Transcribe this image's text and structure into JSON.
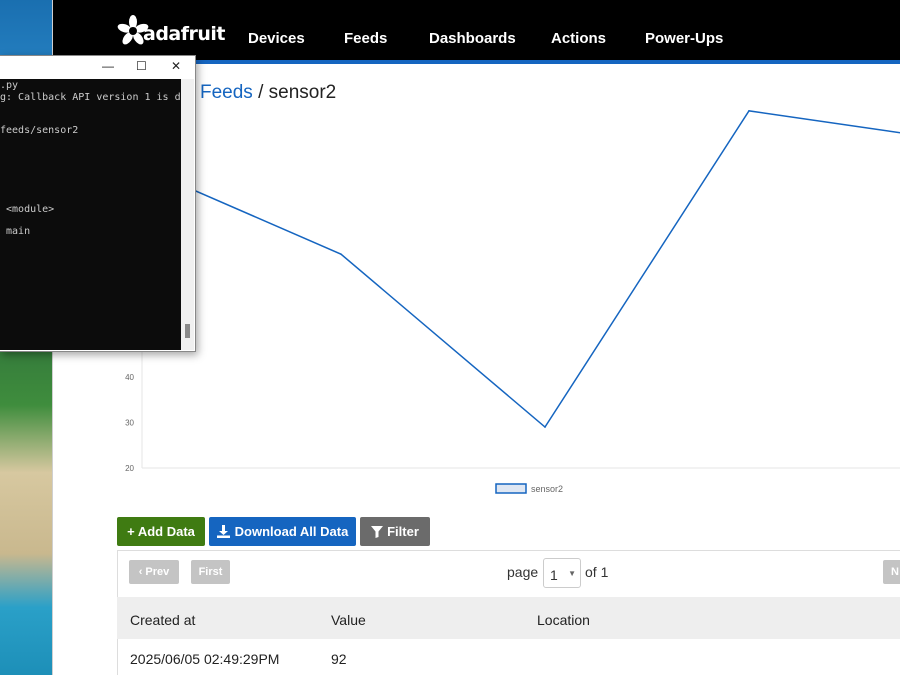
{
  "nav": {
    "logo_text": "adafruit",
    "items": [
      "Devices",
      "Feeds",
      "Dashboards",
      "Actions",
      "Power-Ups"
    ]
  },
  "breadcrumb": {
    "link": "Feeds",
    "separator": "/",
    "current": "sensor2"
  },
  "chart_data": {
    "type": "line",
    "title": "",
    "xlabel": "",
    "ylabel": "",
    "y_ticks_visible": [
      20,
      30,
      40
    ],
    "ylim": [
      20,
      100
    ],
    "series": [
      {
        "name": "sensor2",
        "color": "#1565c0",
        "values": [
          86.5,
          67,
          29,
          98.5,
          92
        ]
      }
    ],
    "legend": {
      "position": "bottom-center",
      "label": "sensor2"
    }
  },
  "toolbar": {
    "add_label": "+ Add Data",
    "download_label": "Download All Data",
    "filter_label": "Filter"
  },
  "pager": {
    "prev_label": "Prev",
    "first_label": "First",
    "next_label": "N",
    "page_label": "page",
    "page_value": "1",
    "of_label": "of 1"
  },
  "table": {
    "headers": [
      "Created at",
      "Value",
      "Location"
    ],
    "rows": [
      {
        "created_at": "2025/06/05 02:49:29PM",
        "value": "92",
        "location": ""
      }
    ]
  },
  "terminal": {
    "lines": [
      ".py",
      "g: Callback API version 1 is d",
      "",
      "feeds/sensor2",
      "",
      "",
      "",
      " <module>",
      "",
      " main"
    ]
  },
  "colors": {
    "accent": "#1565c0",
    "add_button": "#3f7b12",
    "filter_button": "#6b6b6b",
    "nav_background": "#000000"
  }
}
